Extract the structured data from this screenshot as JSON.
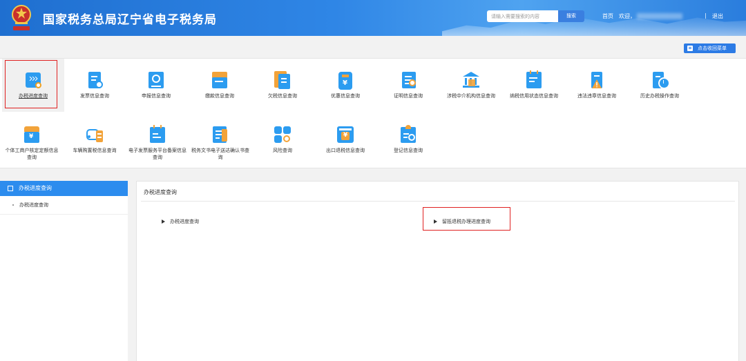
{
  "header": {
    "title": "国家税务总局辽宁省电子税务局",
    "search_placeholder": "请输入需要搜索的内容",
    "search_button": "搜索",
    "home_link": "首页",
    "welcome": "欢迎，",
    "separator": "|",
    "logout": "退出"
  },
  "toolbar": {
    "collapse_menu": "点击收回菜单"
  },
  "menu": {
    "row1": [
      {
        "label": "办税进度查询",
        "icon": "progress-query-icon"
      },
      {
        "label": "发票信息查询",
        "icon": "invoice-query-icon"
      },
      {
        "label": "申报信息查询",
        "icon": "declaration-query-icon"
      },
      {
        "label": "缴款信息查询",
        "icon": "payment-query-icon"
      },
      {
        "label": "欠税信息查询",
        "icon": "tax-arrears-query-icon"
      },
      {
        "label": "优惠信息查询",
        "icon": "preferential-query-icon"
      },
      {
        "label": "证明信息查询",
        "icon": "certificate-query-icon"
      },
      {
        "label": "涉税中介机构信息查询",
        "icon": "tax-agency-query-icon"
      },
      {
        "label": "纳税信用状态信息查询",
        "icon": "credit-status-query-icon"
      },
      {
        "label": "违法违章信息查询",
        "icon": "violation-query-icon"
      },
      {
        "label": "历史办税操作查询",
        "icon": "history-operation-icon"
      }
    ],
    "row2": [
      {
        "label": "个体工商户核定定额信息查询",
        "icon": "individual-quota-icon"
      },
      {
        "label": "车辆购置税信息查询",
        "icon": "vehicle-tax-icon"
      },
      {
        "label": "电子发票服务平台备案信息查询",
        "icon": "e-invoice-platform-icon"
      },
      {
        "label": "税务文书电子送达确认书查询",
        "icon": "e-document-icon"
      },
      {
        "label": "风险查询",
        "icon": "risk-query-icon"
      },
      {
        "label": "出口退税信息查询",
        "icon": "export-rebate-icon"
      },
      {
        "label": "登记信息查询",
        "icon": "registration-query-icon"
      }
    ]
  },
  "sidebar": {
    "header": "办税进度查询",
    "items": [
      "办税进度查询"
    ]
  },
  "content": {
    "title": "办税进度查询",
    "links": [
      "办税进度查询",
      "留抵退税办理进度查询"
    ]
  },
  "colors": {
    "header_blue": "#2f86e6",
    "accent_blue": "#2c8cee",
    "highlight_red": "#e02020"
  }
}
